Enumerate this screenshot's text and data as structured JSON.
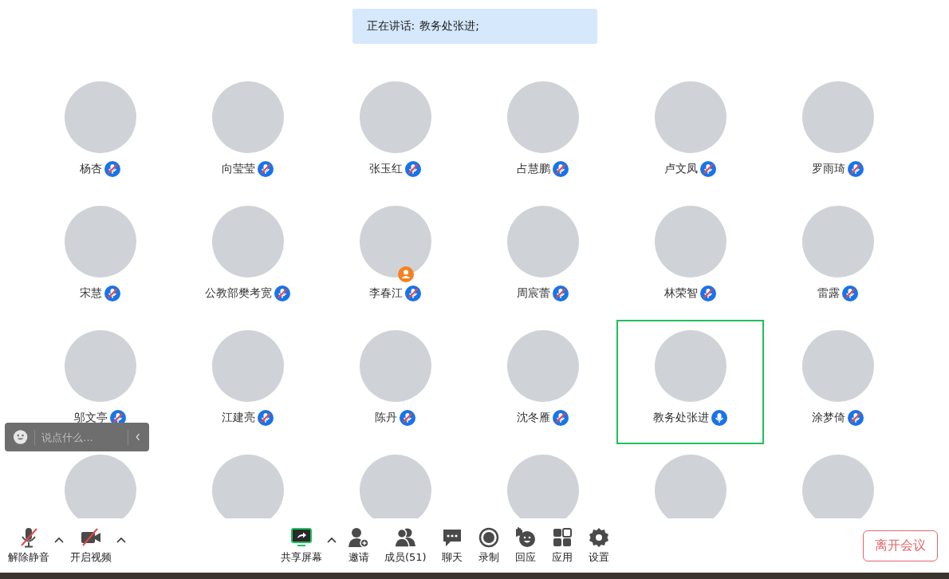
{
  "speaker_banner": {
    "label": "正在讲话:",
    "name": "教务处张进;"
  },
  "participants": [
    {
      "name": "杨杏",
      "muted": true,
      "host": false,
      "speaking": false
    },
    {
      "name": "向莹莹",
      "muted": true,
      "host": false,
      "speaking": false
    },
    {
      "name": "张玉红",
      "muted": true,
      "host": false,
      "speaking": false
    },
    {
      "name": "占慧鹏",
      "muted": true,
      "host": false,
      "speaking": false
    },
    {
      "name": "卢文凤",
      "muted": true,
      "host": false,
      "speaking": false
    },
    {
      "name": "罗雨琦",
      "muted": true,
      "host": false,
      "speaking": false
    },
    {
      "name": "宋慧",
      "muted": true,
      "host": false,
      "speaking": false
    },
    {
      "name": "公教部樊考宽",
      "muted": true,
      "host": false,
      "speaking": false
    },
    {
      "name": "李春江",
      "muted": true,
      "host": true,
      "speaking": false
    },
    {
      "name": "周宸蕾",
      "muted": true,
      "host": false,
      "speaking": false
    },
    {
      "name": "林荣智",
      "muted": true,
      "host": false,
      "speaking": false
    },
    {
      "name": "雷露",
      "muted": true,
      "host": false,
      "speaking": false
    },
    {
      "name": "邬文亭",
      "muted": true,
      "host": false,
      "speaking": false
    },
    {
      "name": "江建亮",
      "muted": true,
      "host": false,
      "speaking": false
    },
    {
      "name": "陈丹",
      "muted": true,
      "host": false,
      "speaking": false
    },
    {
      "name": "沈冬雁",
      "muted": true,
      "host": false,
      "speaking": false
    },
    {
      "name": "教务处张进",
      "muted": false,
      "host": false,
      "speaking": true
    },
    {
      "name": "涂梦倚",
      "muted": true,
      "host": false,
      "speaking": false
    },
    {
      "host": false,
      "speaking": false
    },
    {
      "host": false,
      "speaking": false
    },
    {
      "host": false,
      "speaking": false
    },
    {
      "host": false,
      "speaking": false
    },
    {
      "host": false,
      "speaking": false
    },
    {
      "host": false,
      "speaking": false
    }
  ],
  "chat_input": {
    "placeholder": "说点什么..."
  },
  "toolbar_left": [
    {
      "kind": "mic",
      "label": "解除静音",
      "off": true,
      "caret": true
    },
    {
      "kind": "video",
      "label": "开启视频",
      "off": true,
      "caret": true
    }
  ],
  "toolbar_center": [
    {
      "kind": "share",
      "label": "共享屏幕",
      "caret": true
    },
    {
      "kind": "invite",
      "label": "邀请",
      "caret": false
    },
    {
      "kind": "members",
      "label": "成员(51)",
      "caret": false
    },
    {
      "kind": "chat",
      "label": "聊天",
      "caret": false
    },
    {
      "kind": "record",
      "label": "录制",
      "caret": false
    },
    {
      "kind": "react",
      "label": "回应",
      "caret": false
    },
    {
      "kind": "apps",
      "label": "应用",
      "caret": false
    },
    {
      "kind": "settings",
      "label": "设置",
      "caret": false
    }
  ],
  "leave_button": "离开会议"
}
